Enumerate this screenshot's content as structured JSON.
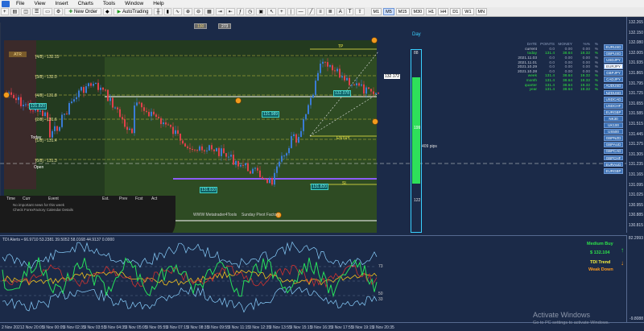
{
  "menu": {
    "items": [
      "File",
      "View",
      "Insert",
      "Charts",
      "Tools",
      "Window",
      "Help"
    ]
  },
  "toolbar": {
    "new_order_label": "New Order",
    "autotrading_label": "AutoTrading",
    "timeframes": [
      "M1",
      "M5",
      "M15",
      "M30",
      "H1",
      "H4",
      "D1",
      "W1",
      "MN"
    ],
    "active_timeframe": "M5"
  },
  "chart": {
    "top_box_left": "130",
    "top_box_right": "273",
    "atr_label": "ATR",
    "today_label": "Today",
    "open_label": "Open",
    "entry_label": "ENTRY",
    "tp_label": "TP",
    "sl_label": "SL",
    "levels": [
      {
        "text": "[4/8] - 132.15",
        "y": 0.18
      },
      {
        "text": "[3/8] - 132.0",
        "y": 0.33
      },
      {
        "text": "[4/8] - 131.8",
        "y": 0.44
      },
      {
        "text": "[2/8] - 131.6",
        "y": 0.56
      },
      {
        "text": "[1/8] - 131.4",
        "y": 0.67
      },
      {
        "text": "[0/8] - 131.3",
        "y": 0.81
      }
    ],
    "price_boxes": {
      "a": "131.820",
      "b": "131.989",
      "c": "131.610",
      "d": "131.820",
      "e": "132.078",
      "f": "131.820",
      "current": "132.172"
    },
    "footer_left": "WWW Metatrader4Tools",
    "footer_right": "Sunday Pivot Factory",
    "daily_label": "Day",
    "daily_top_value": "88",
    "daily_mid_value": "199",
    "daily_pips": "409 pips",
    "daily_bottom_value": "122"
  },
  "news": {
    "headers": [
      "Time",
      "Curr",
      "Event",
      "Est.",
      "Prev",
      "Fcst",
      "Act"
    ],
    "rows": [
      "No important news for this week",
      "Check ForexFactory Calendar Details"
    ]
  },
  "stats": {
    "columns": [
      "DATE",
      "POINTS",
      "MONEY",
      "%%",
      "%"
    ],
    "rows": [
      {
        "label": "current",
        "points": "0.0",
        "money": "0.00",
        "pct": "0.00",
        "pct2": "%",
        "green": false
      },
      {
        "label": "today",
        "points": "131.4",
        "money": "38.64",
        "pct": "19.32",
        "pct2": "%",
        "green": true
      },
      {
        "label": "2021.11.03",
        "points": "0.0",
        "money": "0.00",
        "pct": "0.00",
        "pct2": "%",
        "green": false
      },
      {
        "label": "2021.11.01",
        "points": "0.0",
        "money": "0.00",
        "pct": "0.00",
        "pct2": "%",
        "green": false
      },
      {
        "label": "2021.10.29",
        "points": "0.0",
        "money": "0.00",
        "pct": "0.00",
        "pct2": "%",
        "green": false
      },
      {
        "label": "2021.10.28",
        "points": "0.0",
        "money": "0.00",
        "pct": "0.00",
        "pct2": "%",
        "green": false
      },
      {
        "label": "week",
        "points": "131.4",
        "money": "38.64",
        "pct": "19.32",
        "pct2": "%",
        "green": true
      },
      {
        "label": "month",
        "points": "131.4",
        "money": "38.64",
        "pct": "19.32",
        "pct2": "%",
        "green": true
      },
      {
        "label": "quarter",
        "points": "131.4",
        "money": "38.64",
        "pct": "19.32",
        "pct2": "%",
        "green": true
      },
      {
        "label": "year",
        "points": "131.4",
        "money": "38.64",
        "pct": "19.32",
        "pct2": "%",
        "green": true
      }
    ]
  },
  "pairs": [
    "EURUSD",
    "GBPUSD",
    "USDJPY",
    "EURJPY",
    "GBPJPY",
    "CADJPY",
    "AUDUSD",
    "NZDUSD",
    "USDCAD",
    "USDCHF",
    "EURGBP",
    "NK30",
    "UK100",
    "US500",
    "GBPNZD",
    "GBPAUD",
    "GBPCAD",
    "GBPCHF",
    "EURAUD",
    "EURGBP"
  ],
  "selected_pair": "EURJPY",
  "price_axis": [
    "132.265",
    "132.150",
    "132.080",
    "132.005",
    "131.935",
    "131.865",
    "131.795",
    "131.725",
    "131.655",
    "131.585",
    "131.515",
    "131.445",
    "131.375",
    "131.305",
    "131.235",
    "131.165",
    "131.095",
    "131.025",
    "130.955",
    "130.885",
    "130.815"
  ],
  "sub": {
    "title": "TDI Alerts • 66.9710 53.2381 39.5052 58.0168 44.9137 0.0000",
    "axis_top": "73",
    "axis_mid": "50",
    "axis_bottom": "33",
    "signal_medium": "Medium Buy",
    "signal_price": "$ 132.104",
    "signal_tdi": "TDI Trend",
    "signal_weak": "Weak Down",
    "axis_right_top": "82.2993",
    "axis_right_bottom": "-9.8088"
  },
  "time_axis": [
    "2 Nov 2021",
    "2 Nov 20:05",
    "3 Nov 00:05",
    "3 Nov 02:35",
    "3 Nov 03:55",
    "3 Nov 04:35",
    "3 Nov 05:05",
    "3 Nov 05:55",
    "3 Nov 07:15",
    "3 Nov 08:35",
    "3 Nov 09:55",
    "3 Nov 11:15",
    "3 Nov 12:35",
    "3 Nov 13:55",
    "3 Nov 15:15",
    "3 Nov 16:35",
    "3 Nov 17:55",
    "3 Nov 19:15",
    "3 Nov 20:35"
  ],
  "watermark": {
    "title": "Activate Windows",
    "subtitle": "Go to PC settings to activate Windows."
  }
}
